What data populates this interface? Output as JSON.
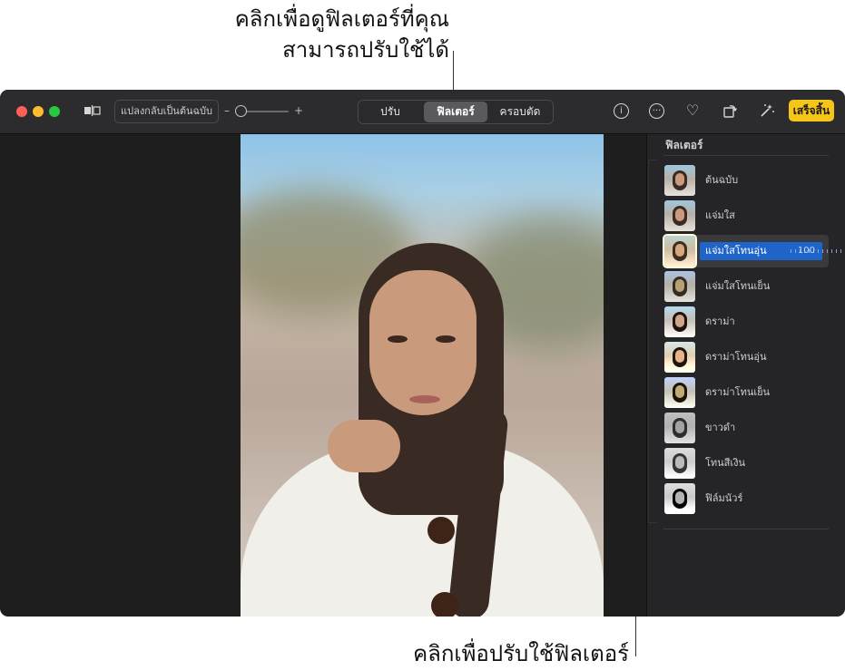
{
  "callouts": {
    "top_line1": "คลิกเพื่อดูฟิลเตอร์ที่คุณ",
    "top_line2": "สามารถปรับใช้ได้",
    "bottom": "คลิกเพื่อปรับใช้ฟิลเตอร์"
  },
  "toolbar": {
    "revert_label": "แปลงกลับเป็นต้นฉบับ",
    "zoom_minus": "–",
    "zoom_plus": "+",
    "tabs": [
      {
        "label": "ปรับ"
      },
      {
        "label": "ฟิลเตอร์"
      },
      {
        "label": "ครอบตัด"
      }
    ],
    "active_tab": "ฟิลเตอร์",
    "done_label": "เสร็จสิ้น",
    "icons": [
      "split-view-icon",
      "info-icon",
      "more-icon",
      "favorite-heart-icon",
      "rotate-icon",
      "auto-enhance-icon"
    ],
    "traffic_lights": {
      "close": "#ff5f57",
      "minimize": "#febc2e",
      "zoom": "#28c840"
    },
    "done_color": "#f5c518"
  },
  "sidebar": {
    "title": "ฟิลเตอร์",
    "filters": [
      {
        "label": "ต้นฉบับ"
      },
      {
        "label": "แจ่มใส"
      },
      {
        "label": "แจ่มใสโทนอุ่น",
        "value": "100"
      },
      {
        "label": "แจ่มใสโทนเย็น"
      },
      {
        "label": "ดราม่า"
      },
      {
        "label": "ดราม่าโทนอุ่น"
      },
      {
        "label": "ดราม่าโทนเย็น"
      },
      {
        "label": "ขาวดำ"
      },
      {
        "label": "โทนสีเงิน"
      },
      {
        "label": "ฟิล์มนัวร์"
      }
    ],
    "selected_filter": "แจ่มใสโทนอุ่น",
    "selected_intensity": 100,
    "slider_color": "#1f65c9"
  }
}
